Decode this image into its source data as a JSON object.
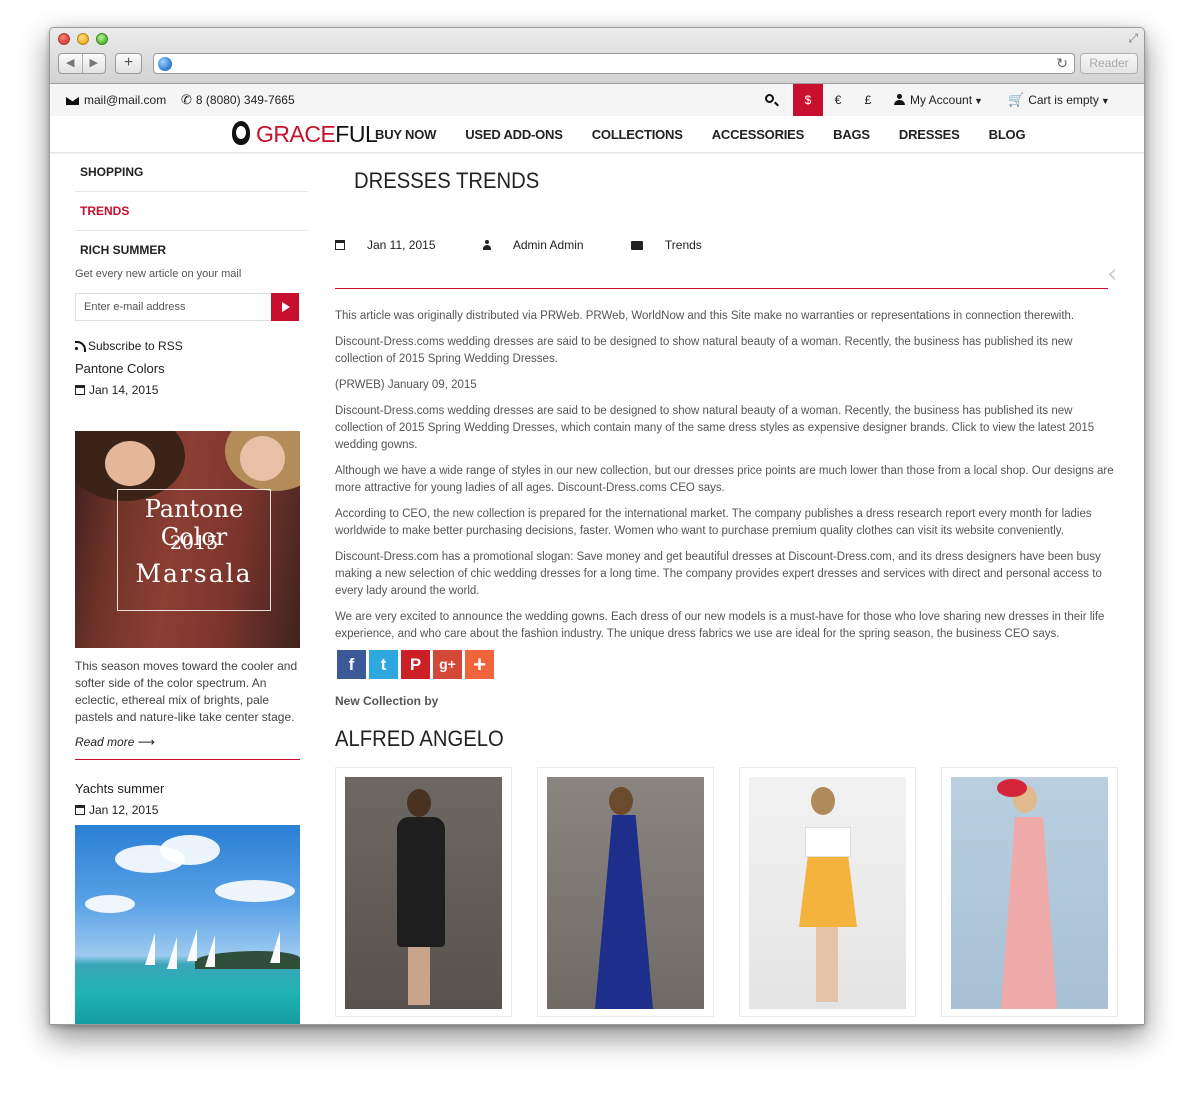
{
  "browser": {
    "reader_label": "Reader"
  },
  "topbar": {
    "email": "mail@mail.com",
    "phone": "8 (8080) 349-7665",
    "currencies": [
      "$",
      "€",
      "£"
    ],
    "account_label": "My Account",
    "cart_label": "Cart is empty"
  },
  "logo": {
    "part1": "GRACE",
    "part2": "FUL"
  },
  "menu": [
    "BUY NOW",
    "USED ADD-ONS",
    "COLLECTIONS",
    "ACCESSORIES",
    "BAGS",
    "DRESSES",
    "BLOG"
  ],
  "sidebar": {
    "categories": [
      "SHOPPING",
      "TRENDS",
      "RICH SUMMER"
    ],
    "subscribe_text": "Get every new article on your mail",
    "email_placeholder": "Enter e-mail address",
    "rss_label": "Subscribe to RSS",
    "posts": [
      {
        "title": "Pantone Colors",
        "date": "Jan 14, 2015",
        "image_text": [
          "Pantone Color",
          "2015",
          "Marsala"
        ],
        "excerpt": "This season moves toward the cooler and softer side of the color spectrum. An eclectic, ethereal mix of brights, pale pastels and nature-like take center stage.",
        "read_more": "Read more"
      },
      {
        "title": "Yachts summer",
        "date": "Jan 12, 2015"
      }
    ]
  },
  "article": {
    "title": "DRESSES TRENDS",
    "date": "Jan 11, 2015",
    "author": "Admin Admin",
    "category": "Trends",
    "paragraphs": [
      "This article was originally distributed via PRWeb. PRWeb, WorldNow and this Site make no warranties or representations in connection therewith.",
      "Discount-Dress.coms wedding dresses are said to be designed to show natural beauty of a woman. Recently, the business has published its new collection of 2015 Spring Wedding Dresses.",
      "(PRWEB) January 09, 2015",
      "Discount-Dress.coms wedding dresses are said to be designed to show natural beauty of a woman. Recently, the business has published its new collection of 2015 Spring Wedding Dresses, which contain many of the same dress styles as expensive designer brands. Click to view the latest 2015 wedding gowns.",
      "Although we have a wide range of styles in our new collection, but our dresses price points are much lower than those from a local shop. Our designs are more attractive for young ladies of all ages. Discount-Dress.coms CEO says.",
      "According to CEO, the new collection is prepared for the international market. The company publishes a dress research report every month for ladies worldwide to make better purchasing decisions, faster. Women who want to purchase premium quality clothes can visit its website conveniently.",
      "Discount-Dress.com has a promotional slogan: Save money and get beautiful dresses at Discount-Dress.com, and its dress designers have been busy making a new selection of chic wedding dresses for a long time. The company provides expert dresses and services with direct and personal access to every lady around the world.",
      "We are very excited to announce the wedding gowns. Each dress of our new models is a must-have for those who love sharing new dresses in their life experience, and who care about the fashion industry. The unique dress fabrics we use are ideal for the spring season, the business CEO says."
    ],
    "share": [
      {
        "icon": "facebook-icon",
        "glyph": "f",
        "color": "#3b5998"
      },
      {
        "icon": "twitter-icon",
        "glyph": "t",
        "color": "#2ea7df"
      },
      {
        "icon": "pinterest-icon",
        "glyph": "P",
        "color": "#cb2027"
      },
      {
        "icon": "google-plus-icon",
        "glyph": "g+",
        "color": "#d34836"
      },
      {
        "icon": "more-share-icon",
        "glyph": "+",
        "color": "#f0643c"
      }
    ],
    "collection_label": "New Collection by",
    "collection_brand": "ALFRED ANGELO"
  },
  "colors": {
    "accent": "#c8102e"
  }
}
